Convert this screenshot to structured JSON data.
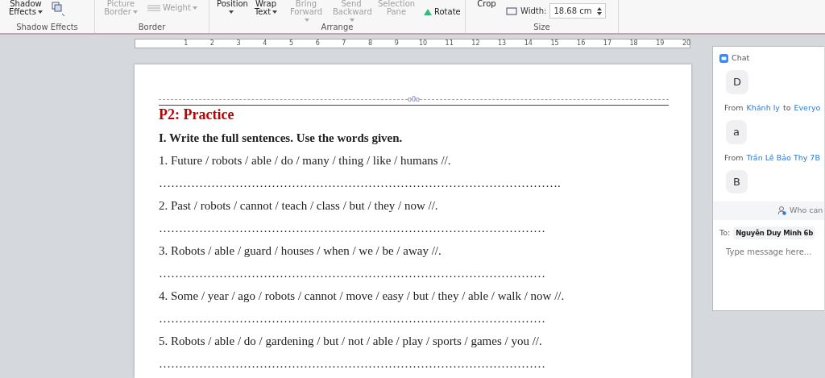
{
  "ribbon": {
    "groups": [
      {
        "label": "Shadow Effects",
        "buttons": [
          {
            "label": "Shadow Effects",
            "kind": "dropdown",
            "disabled": false
          }
        ],
        "icons": true
      },
      {
        "label": "Border",
        "buttons": [
          {
            "label": "Picture Border",
            "kind": "dropdown",
            "disabled": true
          },
          {
            "label": "Weight",
            "kind": "lines",
            "disabled": true
          }
        ],
        "icons": false
      },
      {
        "label": "Arrange",
        "buttons": [
          {
            "label": "Position",
            "kind": "dropdown",
            "disabled": false
          },
          {
            "label": "Wrap Text",
            "kind": "dropdown",
            "disabled": false
          },
          {
            "label": "Bring Forward",
            "kind": "dropdown",
            "disabled": true
          },
          {
            "label": "Send Backward",
            "kind": "dropdown",
            "disabled": true
          },
          {
            "label": "Selection Pane",
            "kind": "plain",
            "disabled": true
          },
          {
            "label": "Rotate",
            "kind": "rotate",
            "disabled": false
          }
        ],
        "icons": false
      },
      {
        "label": "Size",
        "buttons": [
          {
            "label": "Crop",
            "kind": "plain",
            "disabled": false
          }
        ],
        "width": {
          "label": "Width:",
          "value": "18.68 cm"
        },
        "icons": false
      }
    ]
  },
  "ruler": {
    "numbers": [
      "1",
      "2",
      "3",
      "4",
      "5",
      "6",
      "7",
      "8",
      "9",
      "10",
      "11",
      "12",
      "13",
      "14",
      "15",
      "16",
      "17",
      "18",
      "19",
      "20"
    ]
  },
  "document": {
    "divider": "o0o",
    "heading": "P2: Practice",
    "instruction": "I. Write the full sentences. Use the words given.",
    "items": [
      {
        "prompt": "1. Future / robots / able / do / many / thing / like / humans //.",
        "answer": "………………………………………………………………………………………."
      },
      {
        "prompt": "2. Past / robots / cannot / teach / class / but / they / now //.",
        "answer": "……………………………………………………………………………………"
      },
      {
        "prompt": "3. Robots / able / guard / houses / when / we / be / away //.",
        "answer": "……………………………………………………………………………………"
      },
      {
        "prompt": "4. Some / year / ago / robots / cannot / move / easy / but / they / able / walk / now //.",
        "answer": "……………………………………………………………………………………"
      },
      {
        "prompt": "5. Robots / able / do / gardening / but / not / able / play / sports / games / you //.",
        "answer": "……………………………………………………………………………………"
      }
    ]
  },
  "chat": {
    "title": "Chat",
    "messages": [
      {
        "kind": "bubble",
        "text": "D"
      },
      {
        "kind": "sender",
        "from": "From",
        "name": "Khánh ly",
        "to": "to",
        "recipient": "Everyo"
      },
      {
        "kind": "bubble",
        "text": "a"
      },
      {
        "kind": "sender",
        "from": "From",
        "name": "Trần Lê Bảo Thy 7B"
      },
      {
        "kind": "bubble",
        "text": "B"
      }
    ],
    "who_can": "Who can",
    "to_label": "To:",
    "to_value": "Nguyễn Duy Minh 6b",
    "placeholder": "Type message here..."
  }
}
